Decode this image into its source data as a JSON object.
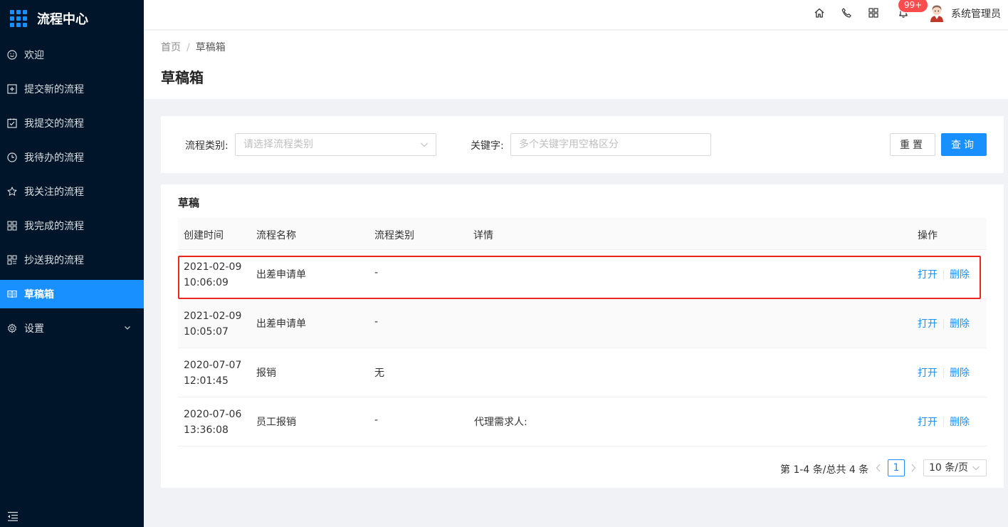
{
  "app": {
    "title": "流程中心"
  },
  "sidebar": {
    "items": [
      {
        "label": "欢迎",
        "icon": "smile-icon"
      },
      {
        "label": "提交新的流程",
        "icon": "plus-square-icon"
      },
      {
        "label": "我提交的流程",
        "icon": "check-square-icon"
      },
      {
        "label": "我待办的流程",
        "icon": "clock-icon"
      },
      {
        "label": "我关注的流程",
        "icon": "star-icon"
      },
      {
        "label": "我完成的流程",
        "icon": "appstore-icon"
      },
      {
        "label": "抄送我的流程",
        "icon": "cc-icon"
      },
      {
        "label": "草稿箱",
        "icon": "book-icon",
        "active": true
      },
      {
        "label": "设置",
        "icon": "gear-icon"
      }
    ]
  },
  "header": {
    "notification_count": "99+",
    "username": "系统管理员"
  },
  "breadcrumb": {
    "home": "首页",
    "separator": "/",
    "current": "草稿箱"
  },
  "page": {
    "title": "草稿箱"
  },
  "filter": {
    "category_label": "流程类别",
    "category_placeholder": "请选择流程类别",
    "keyword_label": "关键字",
    "keyword_placeholder": "多个关键字用空格区分",
    "reset_label": "重置",
    "query_label": "查询"
  },
  "table": {
    "title": "草稿",
    "columns": [
      "创建时间",
      "流程名称",
      "流程类别",
      "详情",
      "操作"
    ],
    "rows": [
      {
        "date": "2021-02-09",
        "time": "10:06:09",
        "name": "出差申请单",
        "category": "-",
        "detail": ""
      },
      {
        "date": "2021-02-09",
        "time": "10:05:07",
        "name": "出差申请单",
        "category": "-",
        "detail": ""
      },
      {
        "date": "2020-07-07",
        "time": "12:01:45",
        "name": "报销",
        "category": "无",
        "detail": ""
      },
      {
        "date": "2020-07-06",
        "time": "13:36:08",
        "name": "员工报销",
        "category": "-",
        "detail": "代理需求人:"
      }
    ],
    "open_label": "打开",
    "delete_label": "删除"
  },
  "pagination": {
    "total_text": "第 1-4 条/总共 4 条",
    "current_page": "1",
    "page_size": "10 条/页"
  },
  "colors": {
    "primary": "#1890ff",
    "sidebar_bg": "#001529",
    "highlight": "#e8261f",
    "badge": "#ff4d4f"
  }
}
